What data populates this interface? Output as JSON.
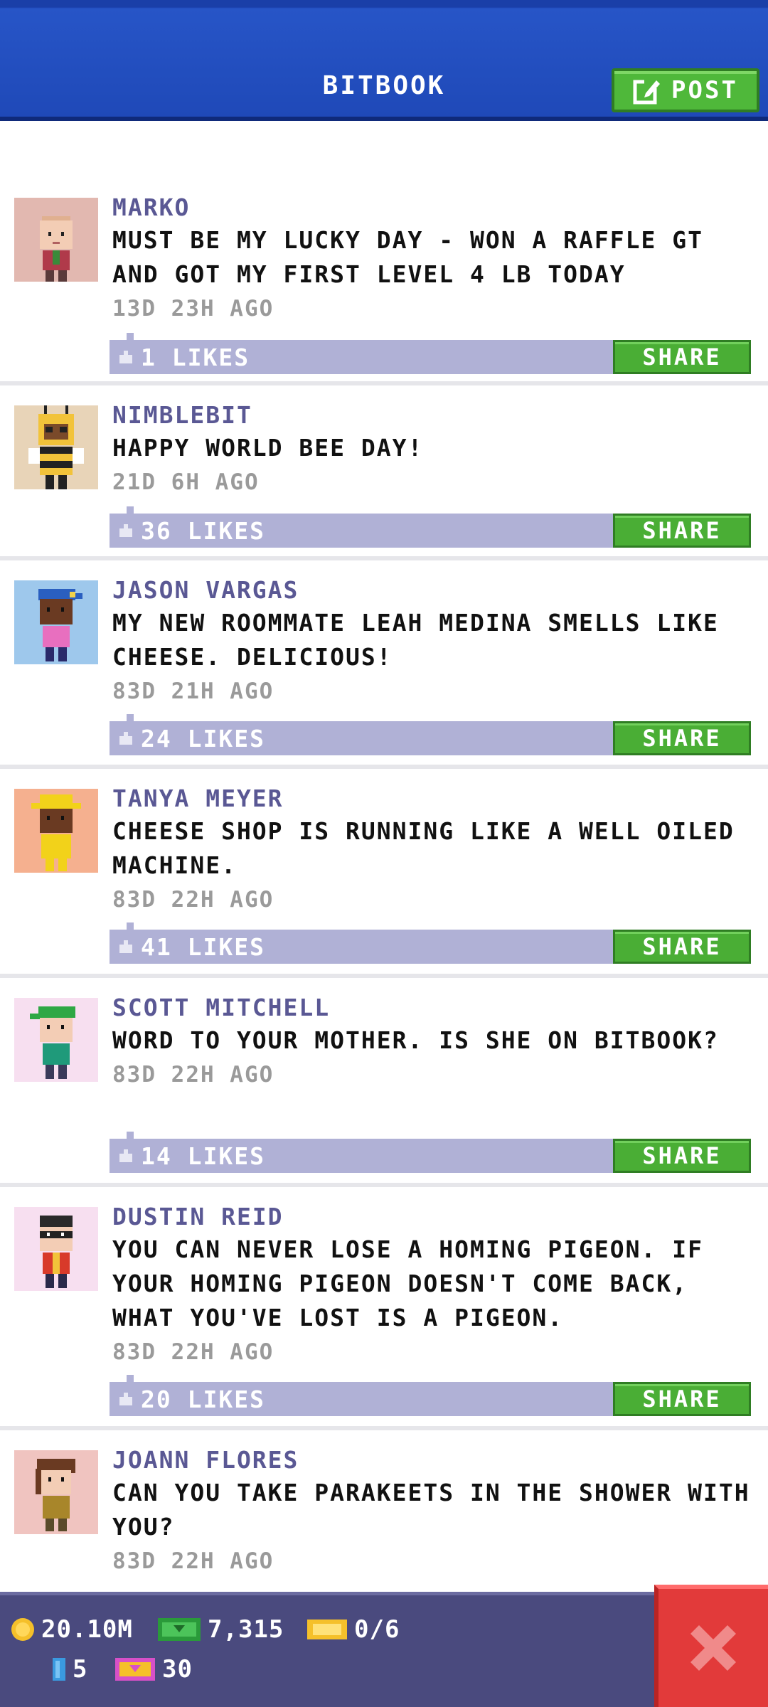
{
  "header": {
    "title": "BITBOOK",
    "post_label": "POST"
  },
  "posts": [
    {
      "author": "MARKO",
      "message": "MUST BE MY LUCKY DAY - WON A RAFFLE GT AND GOT MY FIRST LEVEL 4 LB TODAY",
      "time": "13D 23H AGO",
      "likes": "1 LIKES",
      "share": "SHARE",
      "avatar_bg": "#e2b8b0"
    },
    {
      "author": "NIMBLEBIT",
      "message": "HAPPY WORLD BEE DAY!",
      "time": "21D 6H AGO",
      "likes": "36 LIKES",
      "share": "SHARE",
      "avatar_bg": "#e8d4b8"
    },
    {
      "author": "JASON VARGAS",
      "message": "MY NEW ROOMMATE LEAH MEDINA SMELLS LIKE CHEESE. DELICIOUS!",
      "time": "83D 21H AGO",
      "likes": "24 LIKES",
      "share": "SHARE",
      "avatar_bg": "#9ec8ec"
    },
    {
      "author": "TANYA MEYER",
      "message": "CHEESE SHOP IS RUNNING LIKE A WELL OILED MACHINE.",
      "time": "83D 22H AGO",
      "likes": "41 LIKES",
      "share": "SHARE",
      "avatar_bg": "#f5b08f"
    },
    {
      "author": "SCOTT MITCHELL",
      "message": "WORD TO YOUR MOTHER. IS SHE ON BITBOOK?",
      "time": "83D 22H AGO",
      "likes": "14 LIKES",
      "share": "SHARE",
      "avatar_bg": "#f7dff0"
    },
    {
      "author": "DUSTIN REID",
      "message": "YOU CAN NEVER LOSE A HOMING PIGEON. IF YOUR HOMING PIGEON DOESN'T COME BACK, WHAT YOU'VE LOST IS A PIGEON.",
      "time": "83D 22H AGO",
      "likes": "20 LIKES",
      "share": "SHARE",
      "avatar_bg": "#f7dff0"
    },
    {
      "author": "JOANN FLORES",
      "message": "CAN YOU TAKE PARAKEETS IN THE SHOWER WITH YOU?",
      "time": "83D 22H AGO",
      "avatar_bg": "#f0c4c0"
    }
  ],
  "status": {
    "coins": "20.10M",
    "bux": "7,315",
    "tickets": "0/6",
    "gems": "5",
    "golden": "30"
  },
  "colors": {
    "header": "#1f49b8",
    "share_green": "#4aae35",
    "like_bar": "#b0b1d6",
    "close_red": "#e23a3a"
  }
}
